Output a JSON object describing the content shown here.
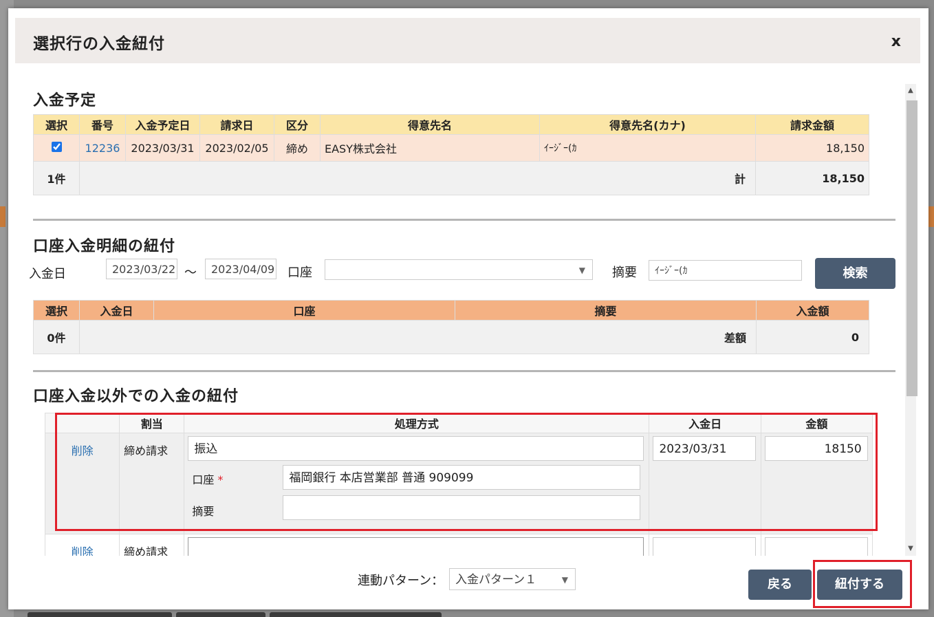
{
  "dialog": {
    "title": "選択行の入金紐付",
    "close_label": "x"
  },
  "section1": {
    "title": "入金予定",
    "headers": [
      "選択",
      "番号",
      "入金予定日",
      "請求日",
      "区分",
      "得意先名",
      "得意先名(カナ)",
      "請求金額"
    ],
    "row": {
      "checked": true,
      "number": "12236",
      "due_date": "2023/03/31",
      "invoice_date": "2023/02/05",
      "category": "締め",
      "customer": "EASY株式会社",
      "customer_kana": "ｲｰｼﾞｰ(ｶ",
      "amount": "18,150"
    },
    "summary": {
      "count": "1件",
      "total_label": "計",
      "total": "18,150"
    }
  },
  "section2": {
    "title": "口座入金明細の紐付",
    "date_label": "入金日",
    "date_from": "2023/03/22",
    "date_sep": "～",
    "date_to": "2023/04/09",
    "account_label": "口座",
    "account_value": "",
    "memo_label": "摘要",
    "memo_value": "ｲｰｼﾞｰ(ｶ",
    "search_label": "検索",
    "headers": [
      "選択",
      "入金日",
      "口座",
      "摘要",
      "入金額"
    ],
    "summary": {
      "count": "0件",
      "diff_label": "差額",
      "diff": "0"
    }
  },
  "section3": {
    "title": "口座入金以外での入金の紐付",
    "headers": [
      "",
      "割当",
      "処理方式",
      "入金日",
      "金額"
    ],
    "rows": [
      {
        "delete_label": "削除",
        "allocation": "締め請求",
        "method": "振込",
        "account_label": "口座",
        "required_mark": "*",
        "account_value": "福岡銀行 本店営業部 普通 909099",
        "memo_label": "摘要",
        "memo_value": "",
        "date": "2023/03/31",
        "amount": "18150"
      },
      {
        "delete_label": "削除",
        "allocation": "締め請求",
        "method": "",
        "date": "",
        "amount": ""
      }
    ]
  },
  "footer": {
    "pattern_label": "連動パターン：",
    "pattern_value": "入金パターン１",
    "back_label": "戻る",
    "submit_label": "紐付する"
  },
  "colors": {
    "accent_button": "#4a5c72",
    "highlight_red": "#e0202a",
    "table1_header": "#fbe6a7",
    "table2_header": "#f4b183"
  }
}
